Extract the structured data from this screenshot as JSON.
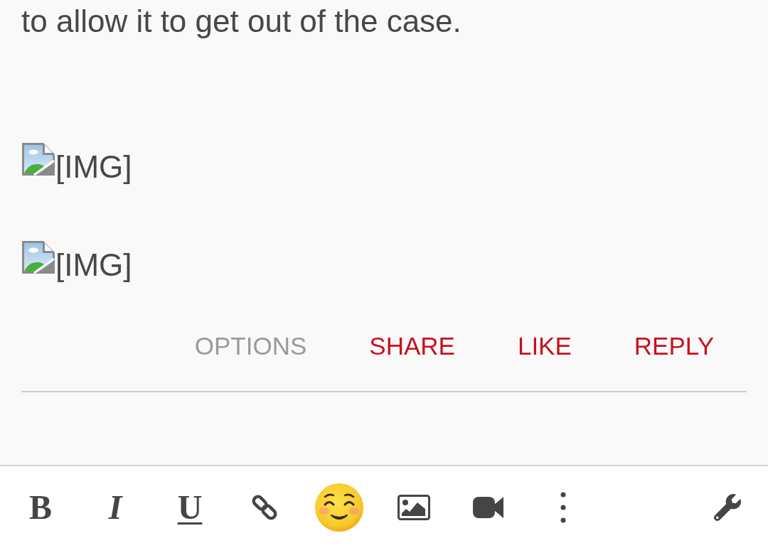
{
  "post": {
    "body": [
      {
        "kind": "text",
        "text": "to allow it to get out of the case."
      },
      {
        "kind": "image",
        "alt": "[IMG]"
      },
      {
        "kind": "image",
        "alt": "[IMG]"
      }
    ],
    "actions": [
      {
        "kind": "menu",
        "label": "OPTIONS"
      },
      {
        "kind": "action",
        "label": "SHARE"
      },
      {
        "kind": "action",
        "label": "LIKE"
      },
      {
        "kind": "action",
        "label": "REPLY"
      }
    ]
  },
  "editor_toolbar": {
    "buttons": [
      {
        "kind": "bold",
        "label": "B"
      },
      {
        "kind": "italic",
        "label": "I"
      },
      {
        "kind": "underline",
        "label": "U"
      },
      {
        "kind": "link"
      },
      {
        "kind": "emoji"
      },
      {
        "kind": "image"
      },
      {
        "kind": "video"
      },
      {
        "kind": "more"
      },
      {
        "kind": "settings"
      }
    ]
  }
}
